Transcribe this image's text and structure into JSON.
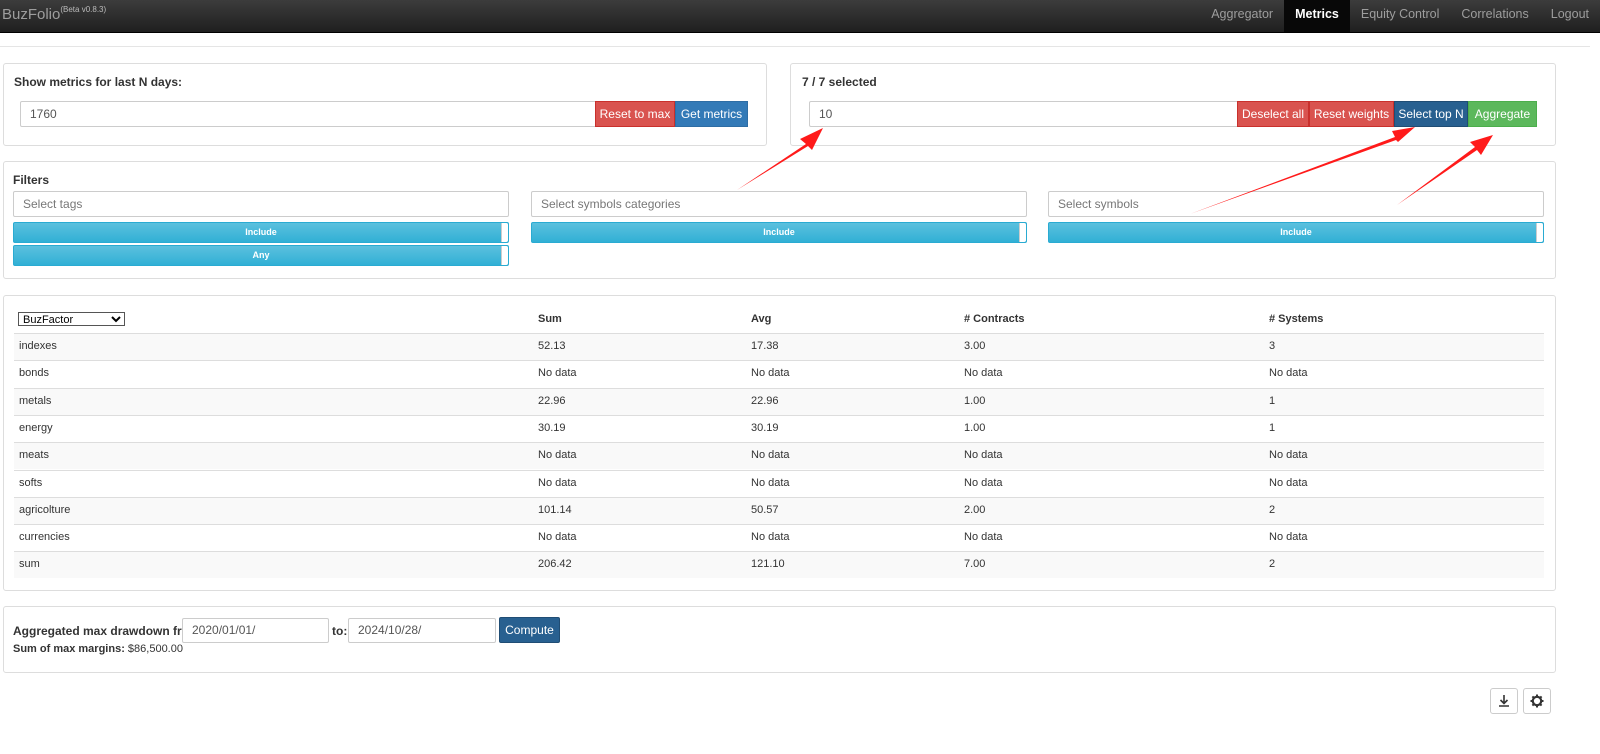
{
  "navbar": {
    "brand": "BuzFolio",
    "version": "(Beta v0.8.3)",
    "items": [
      {
        "label": "Aggregator",
        "active": false
      },
      {
        "label": "Metrics",
        "active": true
      },
      {
        "label": "Equity Control",
        "active": false
      },
      {
        "label": "Correlations",
        "active": false
      },
      {
        "label": "Logout",
        "active": false
      }
    ]
  },
  "metrics_panel": {
    "label": "Show metrics for last N days:",
    "days_value": "1760",
    "reset_label": "Reset to max",
    "get_label": "Get metrics"
  },
  "selection_panel": {
    "label": "7 / 7 selected",
    "n_value": "10",
    "deselect_label": "Deselect all",
    "reset_weights_label": "Reset weights",
    "select_top_label": "Select top N",
    "aggregate_label": "Aggregate"
  },
  "filters": {
    "title": "Filters",
    "tags_placeholder": "Select tags",
    "categories_placeholder": "Select symbols categories",
    "symbols_placeholder": "Select symbols",
    "include_label": "Include",
    "any_label": "Any"
  },
  "table": {
    "metric_select": "BuzFactor",
    "headers": [
      "Sum",
      "Avg",
      "# Contracts",
      "# Systems"
    ],
    "rows": [
      [
        "indexes",
        "52.13",
        "17.38",
        "3.00",
        "3"
      ],
      [
        "bonds",
        "No data",
        "No data",
        "No data",
        "No data"
      ],
      [
        "metals",
        "22.96",
        "22.96",
        "1.00",
        "1"
      ],
      [
        "energy",
        "30.19",
        "30.19",
        "1.00",
        "1"
      ],
      [
        "meats",
        "No data",
        "No data",
        "No data",
        "No data"
      ],
      [
        "softs",
        "No data",
        "No data",
        "No data",
        "No data"
      ],
      [
        "agricolture",
        "101.14",
        "50.57",
        "2.00",
        "2"
      ],
      [
        "currencies",
        "No data",
        "No data",
        "No data",
        "No data"
      ],
      [
        "sum",
        "206.42",
        "121.10",
        "7.00",
        "2"
      ]
    ]
  },
  "drawdown": {
    "label": "Aggregated max drawdown from:",
    "from_value": "2020/01/01/",
    "to_label": "to:",
    "to_value": "2024/10/28/",
    "compute_label": "Compute",
    "margins_label": "Sum of max margins:",
    "margins_value": "$86,500.00"
  },
  "icons": {
    "download": "download-icon",
    "settings": "gear-icon"
  },
  "colors": {
    "danger": "#d9534f",
    "primary": "#337ab7",
    "success": "#5cb85c",
    "info": "#5bc0de",
    "annotation": "#ff0000"
  }
}
